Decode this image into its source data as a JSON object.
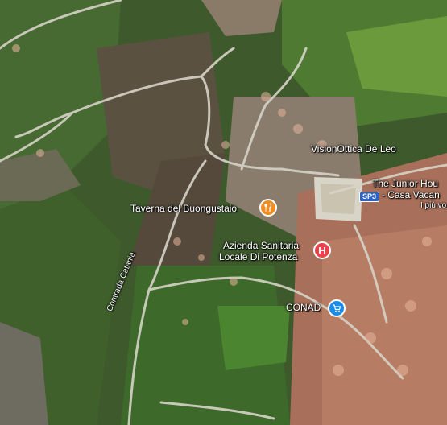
{
  "map": {
    "labels": {
      "visionottica": "VisionOttica De Leo",
      "junior_1": "The Junior Hou",
      "junior_2": "- Casa Vacan",
      "junior_3": "I più vo",
      "taverna": "Taverna del Buongustaio",
      "azienda_1": "Azienda Sanitaria",
      "azienda_2": "Locale Di Potenza",
      "conad": "CONAD",
      "road_contrada": "Contrada Catania",
      "route_sp3": "SP3"
    },
    "icons": {
      "restaurant": "fork-knife-icon",
      "hospital": "hospital-icon",
      "shopping": "shopping-cart-icon"
    },
    "colors": {
      "restaurant_pin": "#f28c1e",
      "hospital_pin": "#e8434c",
      "shopping_pin": "#1a8ce8",
      "route_shield": "#2a64c8"
    }
  }
}
